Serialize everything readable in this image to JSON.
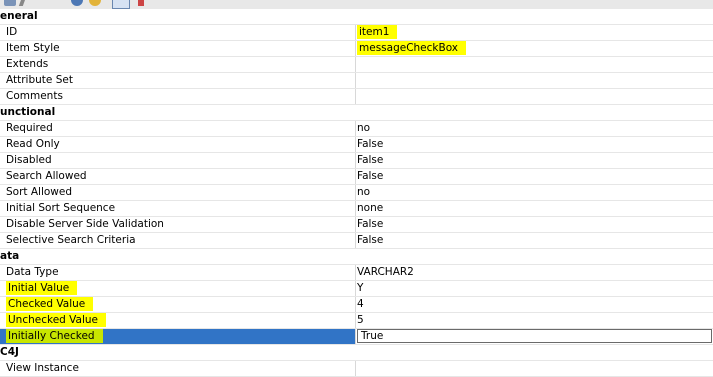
{
  "sections": [
    {
      "title": "eneral",
      "rows": [
        {
          "label": "ID",
          "value": "item1",
          "value_highlight": true
        },
        {
          "label": "Item Style",
          "value": "messageCheckBox",
          "value_highlight": true
        },
        {
          "label": "Extends",
          "value": ""
        },
        {
          "label": "Attribute Set",
          "value": ""
        },
        {
          "label": "Comments",
          "value": ""
        }
      ]
    },
    {
      "title": "unctional",
      "rows": [
        {
          "label": "Required",
          "value": "no"
        },
        {
          "label": "Read Only",
          "value": "False"
        },
        {
          "label": "Disabled",
          "value": "False"
        },
        {
          "label": "Search Allowed",
          "value": "False"
        },
        {
          "label": "Sort Allowed",
          "value": "no"
        },
        {
          "label": "Initial Sort Sequence",
          "value": "none"
        },
        {
          "label": "Disable Server Side Validation",
          "value": "False"
        },
        {
          "label": "Selective Search Criteria",
          "value": "False"
        }
      ]
    },
    {
      "title": "ata",
      "rows": [
        {
          "label": "Data Type",
          "value": "VARCHAR2"
        },
        {
          "label": "Initial Value",
          "value": "Y",
          "label_highlight": true
        },
        {
          "label": "Checked Value",
          "value": "4",
          "label_highlight": true
        },
        {
          "label": "Unchecked Value",
          "value": "5",
          "label_highlight": true
        },
        {
          "label": "Initially Checked",
          "value": "True",
          "label_highlight": true,
          "selected": true
        }
      ]
    },
    {
      "title": "C4J",
      "rows": [
        {
          "label": "View Instance",
          "value": ""
        }
      ]
    }
  ],
  "toolbar_icons": [
    "categorize-icon",
    "wrench-icon",
    "blue-circle-icon",
    "yellow-circle-icon",
    "table-view-icon",
    "close-red-icon"
  ],
  "colors": {
    "highlight": "#ffff00",
    "selection": "#3174c6"
  }
}
